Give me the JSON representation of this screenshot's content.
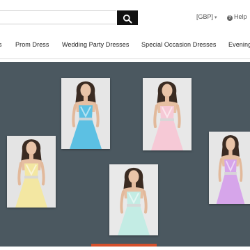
{
  "header": {
    "search": {
      "value": "",
      "placeholder": ""
    },
    "search_icon": "magnifier-icon",
    "currency_label": "[GBP]",
    "help_label": "Help"
  },
  "nav": {
    "items": [
      {
        "label": "s"
      },
      {
        "label": "Prom Dress"
      },
      {
        "label": "Wedding Party Dresses"
      },
      {
        "label": "Special Occasion Dresses"
      },
      {
        "label": "Evening"
      }
    ]
  },
  "colors": {
    "banner_background": "#4b5860",
    "search_button": "#111111",
    "slide_indicator": "#d6502c"
  },
  "banner": {
    "dresses": [
      {
        "dress_color": "#5cc0e3",
        "backdrop": "#e6e6e6"
      },
      {
        "dress_color": "#f6c9d6",
        "backdrop": "#e8e8e8"
      },
      {
        "dress_color": "#f3e7a2",
        "backdrop": "#e4e4e4"
      },
      {
        "dress_color": "#c3ece4",
        "backdrop": "#e9e9e9"
      },
      {
        "dress_color": "#d6a5ea",
        "backdrop": "#e6e6e6"
      }
    ]
  }
}
